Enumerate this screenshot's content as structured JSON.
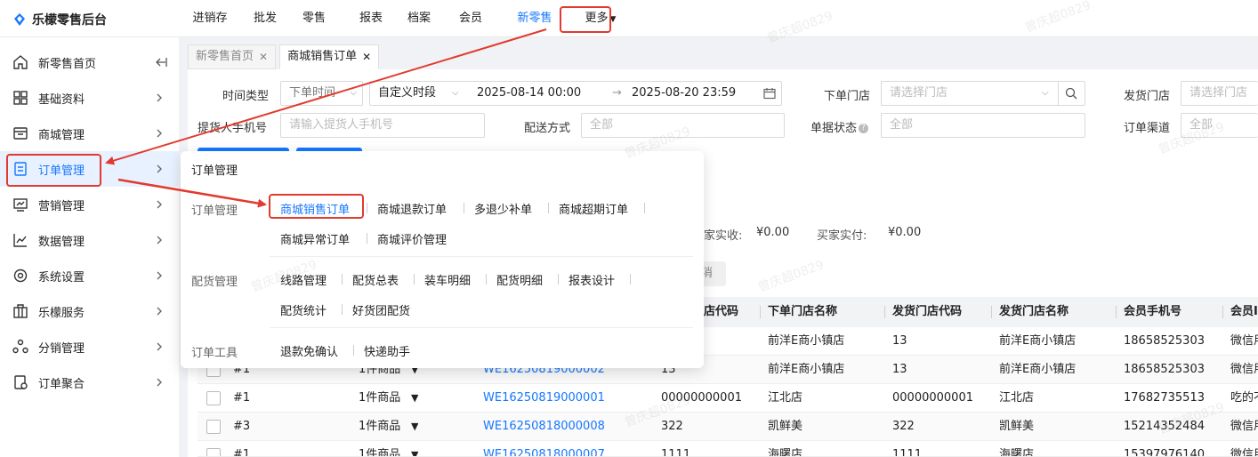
{
  "app": {
    "title": "乐檬零售后台"
  },
  "nav": {
    "items": [
      "进销存",
      "批发",
      "零售",
      "报表",
      "档案",
      "会员",
      "新零售",
      "更多"
    ]
  },
  "sidebar": {
    "items": [
      {
        "label": "新零售首页",
        "icon": "home-icon"
      },
      {
        "label": "基础资料",
        "icon": "grid-icon"
      },
      {
        "label": "商城管理",
        "icon": "store-icon"
      },
      {
        "label": "订单管理",
        "icon": "order-icon"
      },
      {
        "label": "营销管理",
        "icon": "marketing-icon"
      },
      {
        "label": "数据管理",
        "icon": "chart-icon"
      },
      {
        "label": "系统设置",
        "icon": "gear-icon"
      },
      {
        "label": "乐檬服务",
        "icon": "service-icon"
      },
      {
        "label": "分销管理",
        "icon": "distribution-icon"
      },
      {
        "label": "订单聚合",
        "icon": "aggregate-icon"
      }
    ]
  },
  "tabs": [
    {
      "label": "新零售首页"
    },
    {
      "label": "商城销售订单"
    }
  ],
  "filters": {
    "time_type_label": "时间类型",
    "time_type_value": "下单时间",
    "period_value": "自定义时段",
    "date_start": "2025-08-14 00:00",
    "date_end": "2025-08-20 23:59",
    "order_store_label": "下单门店",
    "order_store_placeholder": "请选择门店",
    "ship_store_label": "发货门店",
    "ship_store_placeholder": "请选择门店",
    "phone_label": "提货人手机号",
    "phone_placeholder": "请输入提货人手机号",
    "delivery_label": "配送方式",
    "delivery_value": "全部",
    "status_label": "单据状态",
    "status_value": "全部",
    "channel_label": "订单渠道",
    "channel_value": "全部"
  },
  "summary": {
    "received_label": "家实收:",
    "received_value": "¥0.00",
    "paid_label": "买家实付:",
    "paid_value": "¥0.00",
    "cancel_fragment": "消"
  },
  "table": {
    "headers": [
      "店代码",
      "下单门店名称",
      "发货门店代码",
      "发货门店名称",
      "会员手机号",
      "会员I"
    ],
    "rows": [
      {
        "no": "",
        "count": "",
        "order": "",
        "code": "",
        "store": "前洋E商小镇店",
        "ship_code": "13",
        "ship_store": "前洋E商小镇店",
        "phone": "18658525303",
        "member": "微信用"
      },
      {
        "no": "#1",
        "count": "1件商品",
        "order": "WE16250819000002",
        "code": "13",
        "store": "前洋E商小镇店",
        "ship_code": "13",
        "ship_store": "前洋E商小镇店",
        "phone": "18658525303",
        "member": "微信用"
      },
      {
        "no": "#1",
        "count": "1件商品",
        "order": "WE16250819000001",
        "code": "00000000001",
        "store": "江北店",
        "ship_code": "00000000001",
        "ship_store": "江北店",
        "phone": "17682735513",
        "member": "吃的不"
      },
      {
        "no": "#3",
        "count": "1件商品",
        "order": "WE16250818000008",
        "code": "322",
        "store": "凯鲜美",
        "ship_code": "322",
        "ship_store": "凯鲜美",
        "phone": "15214352484",
        "member": "微信用"
      },
      {
        "no": "#1",
        "count": "1件商品",
        "order": "WE16250818000007",
        "code": "1111",
        "store": "海曙店",
        "ship_code": "1111",
        "ship_store": "海曙店",
        "phone": "15397976140",
        "member": "微信用"
      }
    ]
  },
  "menu": {
    "title": "订单管理",
    "groups": [
      {
        "label": "订单管理",
        "items": [
          "商城销售订单",
          "商城退款订单",
          "多退少补单",
          "商城超期订单",
          "商城异常订单",
          "商城评价管理"
        ]
      },
      {
        "label": "配货管理",
        "items": [
          "线路管理",
          "配货总表",
          "装车明细",
          "配货明细",
          "报表设计",
          "配货统计",
          "好货团配货"
        ]
      },
      {
        "label": "订单工具",
        "items": [
          "退款免确认",
          "快递助手"
        ]
      }
    ]
  },
  "watermark": "曾庆超0829",
  "colors": {
    "accent": "#1677ff",
    "highlight": "#e23a2e"
  }
}
